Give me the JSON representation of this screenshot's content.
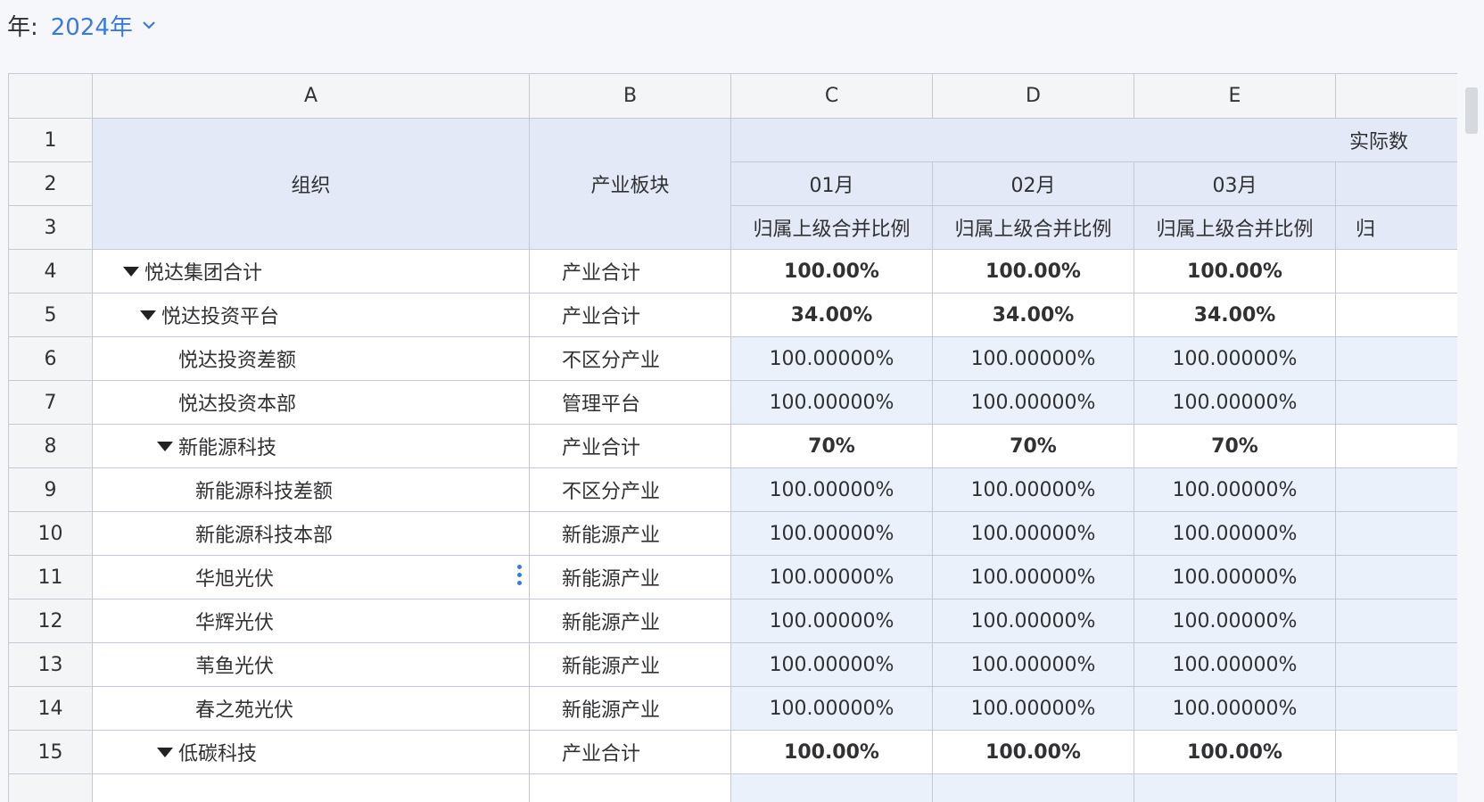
{
  "filter": {
    "label": "年:",
    "selected": "2024年"
  },
  "columns": [
    "A",
    "B",
    "C",
    "D",
    "E"
  ],
  "header": {
    "org": "组织",
    "segment": "产业板块",
    "group": "实际数",
    "months": [
      "01月",
      "02月",
      "03月"
    ],
    "metric": "归属上级合并比例",
    "metric_partial": "归"
  },
  "row_numbers": [
    "1",
    "2",
    "3",
    "4",
    "5",
    "6",
    "7",
    "8",
    "9",
    "10",
    "11",
    "12",
    "13",
    "14",
    "15"
  ],
  "rows": [
    {
      "num": "4",
      "org": "悦达集团合计",
      "seg": "产业合计",
      "indent": 0,
      "collapsible": true,
      "bold": true,
      "values": [
        "100.00%",
        "100.00%",
        "100.00%"
      ]
    },
    {
      "num": "5",
      "org": "悦达投资平台",
      "seg": "产业合计",
      "indent": 1,
      "collapsible": true,
      "bold": true,
      "values": [
        "34.00%",
        "34.00%",
        "34.00%"
      ]
    },
    {
      "num": "6",
      "org": "悦达投资差额",
      "seg": "不区分产业",
      "indent": 2,
      "collapsible": false,
      "bold": false,
      "values": [
        "100.00000%",
        "100.00000%",
        "100.00000%"
      ]
    },
    {
      "num": "7",
      "org": "悦达投资本部",
      "seg": "管理平台",
      "indent": 2,
      "collapsible": false,
      "bold": false,
      "values": [
        "100.00000%",
        "100.00000%",
        "100.00000%"
      ]
    },
    {
      "num": "8",
      "org": "新能源科技",
      "seg": "产业合计",
      "indent": 2,
      "collapsible": true,
      "bold": true,
      "values": [
        "70%",
        "70%",
        "70%"
      ]
    },
    {
      "num": "9",
      "org": "新能源科技差额",
      "seg": "不区分产业",
      "indent": 3,
      "collapsible": false,
      "bold": false,
      "values": [
        "100.00000%",
        "100.00000%",
        "100.00000%"
      ]
    },
    {
      "num": "10",
      "org": "新能源科技本部",
      "seg": "新能源产业",
      "indent": 3,
      "collapsible": false,
      "bold": false,
      "values": [
        "100.00000%",
        "100.00000%",
        "100.00000%"
      ]
    },
    {
      "num": "11",
      "org": "华旭光伏",
      "seg": "新能源产业",
      "indent": 3,
      "collapsible": false,
      "bold": false,
      "more": true,
      "values": [
        "100.00000%",
        "100.00000%",
        "100.00000%"
      ]
    },
    {
      "num": "12",
      "org": "华辉光伏",
      "seg": "新能源产业",
      "indent": 3,
      "collapsible": false,
      "bold": false,
      "values": [
        "100.00000%",
        "100.00000%",
        "100.00000%"
      ]
    },
    {
      "num": "13",
      "org": "苇鱼光伏",
      "seg": "新能源产业",
      "indent": 3,
      "collapsible": false,
      "bold": false,
      "values": [
        "100.00000%",
        "100.00000%",
        "100.00000%"
      ]
    },
    {
      "num": "14",
      "org": "春之苑光伏",
      "seg": "新能源产业",
      "indent": 3,
      "collapsible": false,
      "bold": false,
      "values": [
        "100.00000%",
        "100.00000%",
        "100.00000%"
      ]
    },
    {
      "num": "15",
      "org": "低碳科技",
      "seg": "产业合计",
      "indent": 2,
      "collapsible": true,
      "bold": true,
      "values": [
        "100.00%",
        "100.00%",
        "100.00%"
      ]
    }
  ]
}
